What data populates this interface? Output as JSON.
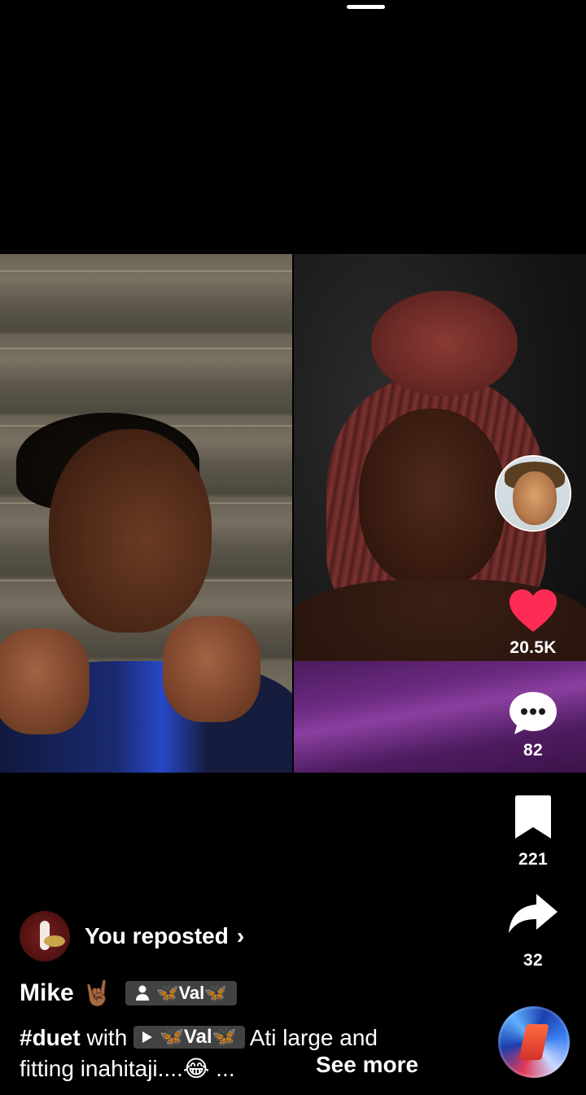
{
  "status_bar": {
    "home_indicator": "home-indicator"
  },
  "video": {
    "layout": "duet",
    "left_clip": "young man with fists raised in front of a block wall",
    "right_clip": "young woman with red braids in a purple velvet top"
  },
  "actions": {
    "likes": "20.5K",
    "comments": "82",
    "saves": "221",
    "shares": "32",
    "like_color": "#fe2c55"
  },
  "repost": {
    "label": "You reposted",
    "chevron": "›"
  },
  "author": {
    "name": "Mike",
    "emoji": "🤘🏾",
    "friend_tag": "🦋Val🦋"
  },
  "caption": {
    "hashtag": "#duet",
    "with_text": " with ",
    "mention": "🦋Val🦋",
    "text_line1": " Ati large and",
    "text_line2": "fitting inahitaji....😂 ...",
    "see_more": "See more"
  },
  "icons": {
    "like": "heart-icon",
    "comment": "comment-icon",
    "save": "bookmark-icon",
    "share": "share-icon",
    "sound": "music-disc-icon"
  }
}
